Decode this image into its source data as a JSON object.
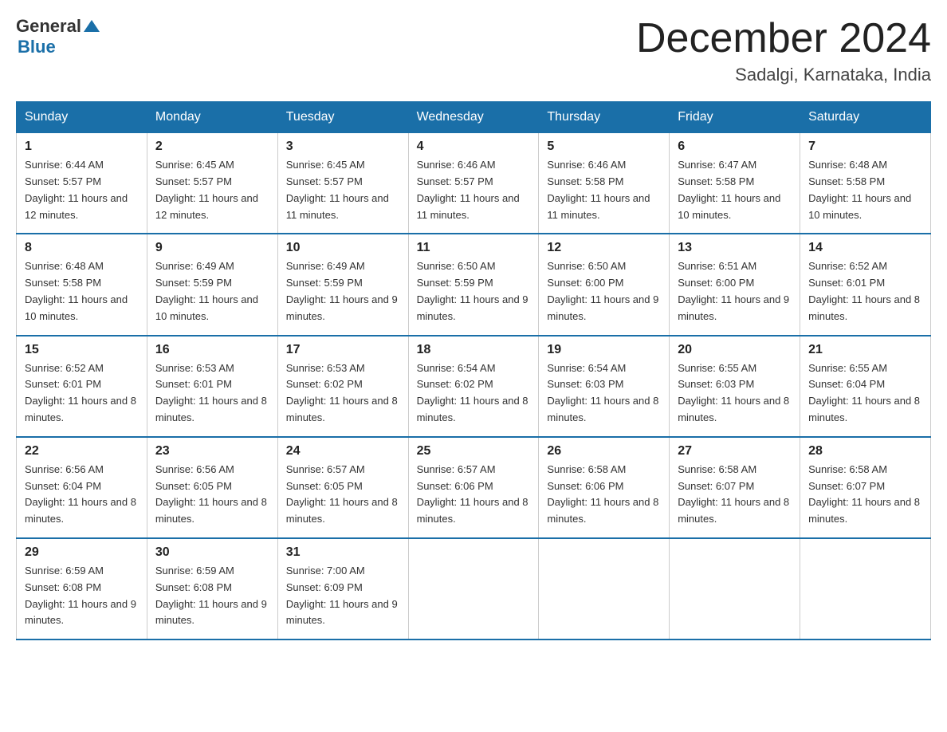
{
  "header": {
    "logo": {
      "general": "General",
      "triangle": "",
      "blue": "Blue"
    },
    "title": "December 2024",
    "location": "Sadalgi, Karnataka, India"
  },
  "calendar": {
    "days_of_week": [
      "Sunday",
      "Monday",
      "Tuesday",
      "Wednesday",
      "Thursday",
      "Friday",
      "Saturday"
    ],
    "weeks": [
      [
        {
          "day": "1",
          "sunrise": "6:44 AM",
          "sunset": "5:57 PM",
          "daylight": "11 hours and 12 minutes."
        },
        {
          "day": "2",
          "sunrise": "6:45 AM",
          "sunset": "5:57 PM",
          "daylight": "11 hours and 12 minutes."
        },
        {
          "day": "3",
          "sunrise": "6:45 AM",
          "sunset": "5:57 PM",
          "daylight": "11 hours and 11 minutes."
        },
        {
          "day": "4",
          "sunrise": "6:46 AM",
          "sunset": "5:57 PM",
          "daylight": "11 hours and 11 minutes."
        },
        {
          "day": "5",
          "sunrise": "6:46 AM",
          "sunset": "5:58 PM",
          "daylight": "11 hours and 11 minutes."
        },
        {
          "day": "6",
          "sunrise": "6:47 AM",
          "sunset": "5:58 PM",
          "daylight": "11 hours and 10 minutes."
        },
        {
          "day": "7",
          "sunrise": "6:48 AM",
          "sunset": "5:58 PM",
          "daylight": "11 hours and 10 minutes."
        }
      ],
      [
        {
          "day": "8",
          "sunrise": "6:48 AM",
          "sunset": "5:58 PM",
          "daylight": "11 hours and 10 minutes."
        },
        {
          "day": "9",
          "sunrise": "6:49 AM",
          "sunset": "5:59 PM",
          "daylight": "11 hours and 10 minutes."
        },
        {
          "day": "10",
          "sunrise": "6:49 AM",
          "sunset": "5:59 PM",
          "daylight": "11 hours and 9 minutes."
        },
        {
          "day": "11",
          "sunrise": "6:50 AM",
          "sunset": "5:59 PM",
          "daylight": "11 hours and 9 minutes."
        },
        {
          "day": "12",
          "sunrise": "6:50 AM",
          "sunset": "6:00 PM",
          "daylight": "11 hours and 9 minutes."
        },
        {
          "day": "13",
          "sunrise": "6:51 AM",
          "sunset": "6:00 PM",
          "daylight": "11 hours and 9 minutes."
        },
        {
          "day": "14",
          "sunrise": "6:52 AM",
          "sunset": "6:01 PM",
          "daylight": "11 hours and 8 minutes."
        }
      ],
      [
        {
          "day": "15",
          "sunrise": "6:52 AM",
          "sunset": "6:01 PM",
          "daylight": "11 hours and 8 minutes."
        },
        {
          "day": "16",
          "sunrise": "6:53 AM",
          "sunset": "6:01 PM",
          "daylight": "11 hours and 8 minutes."
        },
        {
          "day": "17",
          "sunrise": "6:53 AM",
          "sunset": "6:02 PM",
          "daylight": "11 hours and 8 minutes."
        },
        {
          "day": "18",
          "sunrise": "6:54 AM",
          "sunset": "6:02 PM",
          "daylight": "11 hours and 8 minutes."
        },
        {
          "day": "19",
          "sunrise": "6:54 AM",
          "sunset": "6:03 PM",
          "daylight": "11 hours and 8 minutes."
        },
        {
          "day": "20",
          "sunrise": "6:55 AM",
          "sunset": "6:03 PM",
          "daylight": "11 hours and 8 minutes."
        },
        {
          "day": "21",
          "sunrise": "6:55 AM",
          "sunset": "6:04 PM",
          "daylight": "11 hours and 8 minutes."
        }
      ],
      [
        {
          "day": "22",
          "sunrise": "6:56 AM",
          "sunset": "6:04 PM",
          "daylight": "11 hours and 8 minutes."
        },
        {
          "day": "23",
          "sunrise": "6:56 AM",
          "sunset": "6:05 PM",
          "daylight": "11 hours and 8 minutes."
        },
        {
          "day": "24",
          "sunrise": "6:57 AM",
          "sunset": "6:05 PM",
          "daylight": "11 hours and 8 minutes."
        },
        {
          "day": "25",
          "sunrise": "6:57 AM",
          "sunset": "6:06 PM",
          "daylight": "11 hours and 8 minutes."
        },
        {
          "day": "26",
          "sunrise": "6:58 AM",
          "sunset": "6:06 PM",
          "daylight": "11 hours and 8 minutes."
        },
        {
          "day": "27",
          "sunrise": "6:58 AM",
          "sunset": "6:07 PM",
          "daylight": "11 hours and 8 minutes."
        },
        {
          "day": "28",
          "sunrise": "6:58 AM",
          "sunset": "6:07 PM",
          "daylight": "11 hours and 8 minutes."
        }
      ],
      [
        {
          "day": "29",
          "sunrise": "6:59 AM",
          "sunset": "6:08 PM",
          "daylight": "11 hours and 9 minutes."
        },
        {
          "day": "30",
          "sunrise": "6:59 AM",
          "sunset": "6:08 PM",
          "daylight": "11 hours and 9 minutes."
        },
        {
          "day": "31",
          "sunrise": "7:00 AM",
          "sunset": "6:09 PM",
          "daylight": "11 hours and 9 minutes."
        },
        null,
        null,
        null,
        null
      ]
    ]
  }
}
